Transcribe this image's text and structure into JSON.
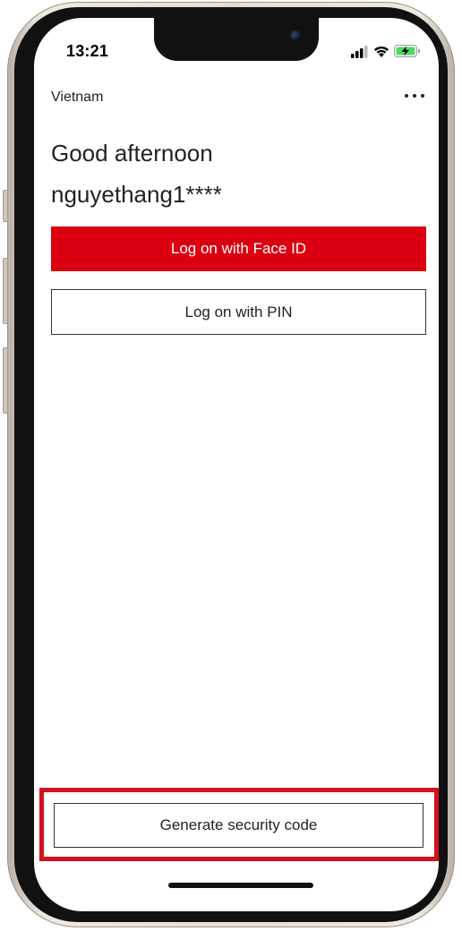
{
  "status_bar": {
    "time": "13:21",
    "icons": [
      "signal-icon",
      "wifi-icon",
      "battery-charging-icon"
    ],
    "battery_color": "#4cd964"
  },
  "header": {
    "country": "Vietnam",
    "more_icon": "more-options-icon"
  },
  "greeting": {
    "line1": "Good afternoon",
    "line2": "nguyethang1****"
  },
  "actions": {
    "face_id_label": "Log on with Face ID",
    "pin_label": "Log on with PIN",
    "generate_code_label": "Generate security code"
  },
  "colors": {
    "brand_red": "#db0011",
    "highlight_red": "#d3121f"
  }
}
